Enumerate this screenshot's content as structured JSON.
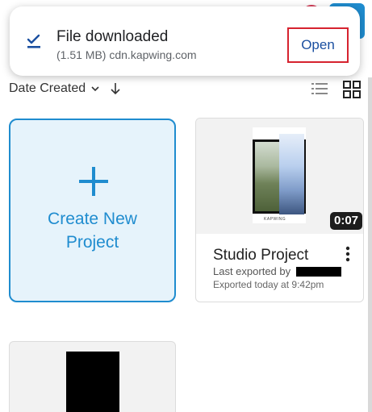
{
  "toast": {
    "title": "File downloaded",
    "subtitle": "(1.51 MB) cdn.kapwing.com",
    "action_label": "Open",
    "icon": "download-done-icon"
  },
  "sort": {
    "label": "Date Created",
    "chevron_icon": "chevron-down-icon",
    "direction_icon": "arrow-down-icon"
  },
  "view_toggle": {
    "list_icon": "list-view-icon",
    "grid_icon": "grid-view-icon"
  },
  "create_card": {
    "label_line1": "Create New",
    "label_line2": "Project",
    "icon": "plus-icon"
  },
  "project": {
    "title": "Studio Project",
    "duration": "0:07",
    "exported_by_label": "Last exported by",
    "exported_time": "Exported today at 9:42pm",
    "more_icon": "more-vertical-icon",
    "thumb_brand": "KAPWING"
  },
  "colors": {
    "accent": "#1f8ccf",
    "card_bg": "#e6f3fb",
    "highlight_border": "#d6232f",
    "open_text": "#1a4fa0"
  }
}
